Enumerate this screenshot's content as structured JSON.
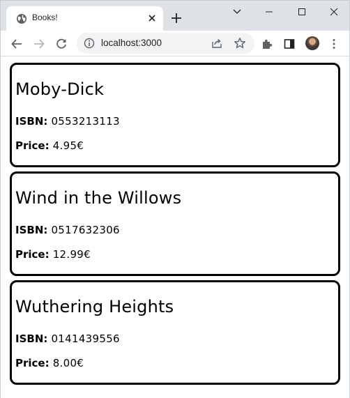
{
  "browser": {
    "tab_title": "Books!",
    "url": "localhost:3000"
  },
  "books": [
    {
      "title": "Moby-Dick",
      "isbn_label": "ISBN:",
      "isbn": "0553213113",
      "price_label": "Price:",
      "price": "4.95€"
    },
    {
      "title": "Wind in the Willows",
      "isbn_label": "ISBN:",
      "isbn": "0517632306",
      "price_label": "Price:",
      "price": "12.99€"
    },
    {
      "title": "Wuthering Heights",
      "isbn_label": "ISBN:",
      "isbn": "0141439556",
      "price_label": "Price:",
      "price": "8.00€"
    }
  ]
}
